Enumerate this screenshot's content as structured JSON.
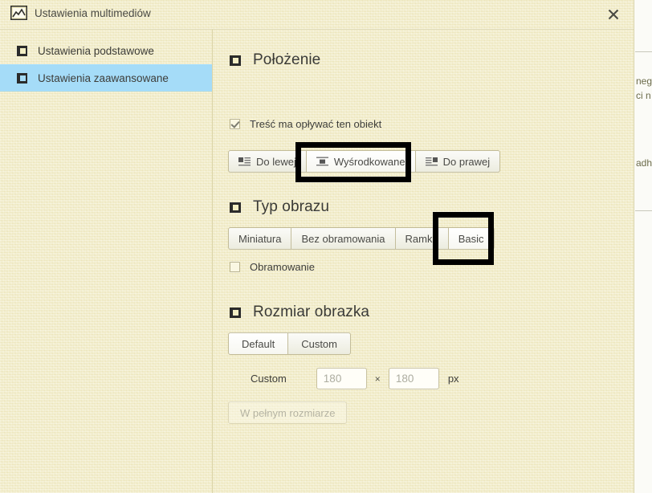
{
  "window": {
    "title": "Ustawienia multimediów",
    "title_icon": "image-icon",
    "close_icon": "close-icon"
  },
  "sidebar": {
    "items": [
      {
        "label": "Ustawienia podstawowe",
        "icon": "page-square-icon",
        "selected": false
      },
      {
        "label": "Ustawienia zaawansowane",
        "icon": "page-square-icon",
        "selected": true
      }
    ],
    "selected_highlight_color": "#a5dcf8"
  },
  "sections": {
    "position": {
      "heading": "Położenie",
      "heading_icon": "collapse-square-icon",
      "checkbox": {
        "label": "Treść ma opływać ten obiekt",
        "checked": true
      },
      "alignment_buttons": [
        {
          "label": "Do lewej",
          "icon": "align-left-icon",
          "active": false
        },
        {
          "label": "Wyśrodkowane",
          "icon": "align-center-icon",
          "active": true
        },
        {
          "label": "Do prawej",
          "icon": "align-right-icon",
          "active": false
        }
      ]
    },
    "image_type": {
      "heading": "Typ obrazu",
      "heading_icon": "collapse-square-icon",
      "type_buttons": [
        {
          "label": "Miniatura",
          "active": false
        },
        {
          "label": "Bez obramowania",
          "active": false
        },
        {
          "label": "Ramka",
          "active": false
        },
        {
          "label": "Basic",
          "active": true
        }
      ],
      "checkbox": {
        "label": "Obramowanie",
        "checked": false
      }
    },
    "image_size": {
      "heading": "Rozmiar obrazka",
      "heading_icon": "collapse-square-icon",
      "mode_buttons": [
        {
          "label": "Default",
          "active": true
        },
        {
          "label": "Custom",
          "active": false
        }
      ],
      "custom_row": {
        "label": "Custom",
        "width_value": "",
        "width_placeholder": "180",
        "separator": "×",
        "height_value": "",
        "height_placeholder": "180",
        "unit": "px"
      },
      "full_size_button": {
        "label": "W pełnym rozmiarze",
        "disabled": true
      }
    }
  },
  "highlights": [
    {
      "target": "Wyśrodkowane",
      "color": "#000000"
    },
    {
      "target": "Basic",
      "color": "#000000"
    }
  ],
  "background_page": {
    "fragments": [
      "neg",
      "ci n",
      "adh"
    ]
  }
}
